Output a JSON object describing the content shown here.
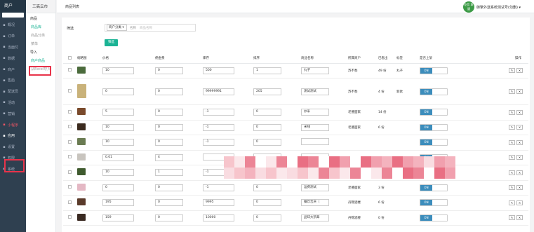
{
  "sidebar": {
    "brand": "商户",
    "brand_sub": "",
    "items": [
      {
        "label": "概况",
        "icon": "home-icon"
      },
      {
        "label": "订单",
        "icon": "list-icon"
      },
      {
        "label": "当面付",
        "icon": "pay-icon"
      },
      {
        "label": "数据",
        "icon": "chart-icon"
      },
      {
        "label": "商户",
        "icon": "shop-icon"
      },
      {
        "label": "售后",
        "icon": "service-icon"
      },
      {
        "label": "配送员",
        "icon": "rider-icon"
      },
      {
        "label": "活动",
        "icon": "activity-icon"
      },
      {
        "label": "营销",
        "icon": "marketing-icon"
      },
      {
        "label": "小程序",
        "icon": "miniapp-icon"
      },
      {
        "label": "应用",
        "icon": "app-icon"
      },
      {
        "label": "设置",
        "icon": "gear-icon"
      },
      {
        "label": "权限",
        "icon": "permission-icon"
      },
      {
        "label": "系统",
        "icon": "system-icon"
      }
    ]
  },
  "subnav": {
    "title": "三高云市",
    "group1": "商品",
    "links1": [
      "商品库",
      "商品分类",
      "菜单"
    ],
    "group2": "导入",
    "links2": [
      "商户商品",
      "从Excel导入"
    ]
  },
  "topbar": {
    "breadcrumb": "商品列表",
    "avatar_text": "吃货 联盟",
    "user": "御擎外送系统测试号(勿删)"
  },
  "filter": {
    "label": "筛选",
    "select": "商户分类",
    "name_label": "名称",
    "placeholder": "商品名称",
    "button": "筛选"
  },
  "table": {
    "headers": [
      "",
      "缩略图",
      "价格",
      "佣金费",
      "库存",
      "排序",
      "商品名称",
      "所属商户",
      "已售出",
      "标签",
      "是否上架",
      "操作"
    ],
    "rows": [
      {
        "price": "10",
        "commission": "0",
        "stock": "500",
        "sort": "1",
        "name": "丸子",
        "merchant": "苏不愁",
        "sold": "49 份",
        "tag": "丸子",
        "status": "ON",
        "color": "#4b6b3c",
        "tall": false
      },
      {
        "price": "0",
        "commission": "0",
        "stock": "99999991",
        "sort": "205",
        "name": "测试测试",
        "merchant": "苏不愁",
        "sold": "4 份",
        "tag": "新款",
        "status": "ON",
        "color": "#c9b27a",
        "tall": true
      },
      {
        "price": "5",
        "commission": "0",
        "stock": "-1",
        "sort": "0",
        "name": "炒米",
        "merchant": "老婆面家",
        "sold": "14 份",
        "tag": "",
        "status": "ON",
        "color": "#7a4a2c",
        "tall": false
      },
      {
        "price": "10",
        "commission": "0",
        "stock": "-1",
        "sort": "0",
        "name": "米线",
        "merchant": "老婆面家",
        "sold": "6 份",
        "tag": "",
        "status": "ON",
        "color": "#3b2a1e",
        "tall": false
      },
      {
        "price": "10",
        "commission": "0",
        "stock": "-1",
        "sort": "0",
        "name": "",
        "merchant": "",
        "sold": "",
        "tag": "",
        "status": "ON",
        "color": "#6a7b52",
        "tall": false
      },
      {
        "price": "0.01",
        "commission": "4",
        "stock": "",
        "sort": "",
        "name": "",
        "merchant": "",
        "sold": "",
        "tag": "",
        "status": "ON",
        "color": "#c8c4be",
        "tall": false
      },
      {
        "price": "10",
        "commission": "1",
        "stock": "-1",
        "sort": "0",
        "name": "特色石锅(大",
        "merchant": "苏不愁",
        "sold": "3 份",
        "tag": "",
        "status": "ON",
        "color": "#3f5a2e",
        "tall": false
      },
      {
        "price": "0",
        "commission": "0",
        "stock": "-1",
        "sort": "0",
        "name": "运费测试",
        "merchant": "老婆面家",
        "sold": "3 份",
        "tag": "",
        "status": "ON",
        "color": "#e4b8c4",
        "tall": false
      },
      {
        "price": "195",
        "commission": "0",
        "stock": "9995",
        "sort": "0",
        "name": "餐饮吉庆（",
        "merchant": "丹锦酒楼",
        "sold": "6 份",
        "tag": "",
        "status": "ON",
        "color": "#5a3a2a",
        "tall": false
      },
      {
        "price": "159",
        "commission": "0",
        "stock": "10000",
        "sort": "0",
        "name": "品味大凯翠",
        "merchant": "丹锦酒楼",
        "sold": "0 份",
        "tag": "",
        "status": "ON",
        "color": "#3a2a22",
        "tall": false
      }
    ]
  },
  "colors": {
    "sidebar": "#2f4050",
    "accent": "#1ab394",
    "switch_on": "#3c8dbc",
    "highlight": "#e8334a"
  }
}
